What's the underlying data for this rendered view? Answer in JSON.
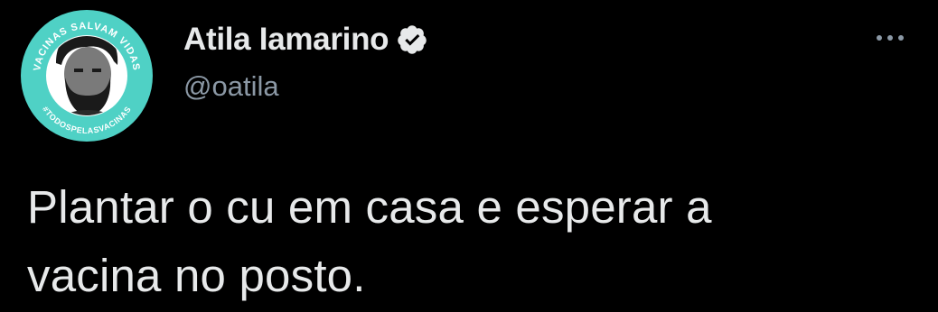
{
  "author": {
    "display_name": "Atila Iamarino",
    "handle": "@oatila",
    "verified": true,
    "avatar": {
      "ring_text_top": "VACINAS SALVAM VIDAS",
      "ring_text_bottom": "#TODOSPELASVACINAS",
      "ring_color": "#4fd1c5"
    }
  },
  "tweet": {
    "text_line_1": "Plantar o cu em casa e esperar a",
    "text_line_2": "vacina no posto."
  },
  "icons": {
    "verified": "verified-badge-icon",
    "more": "more-dots-icon"
  },
  "colors": {
    "background": "#000000",
    "text_primary": "#e7e9ea",
    "text_secondary": "#8b98a5"
  }
}
